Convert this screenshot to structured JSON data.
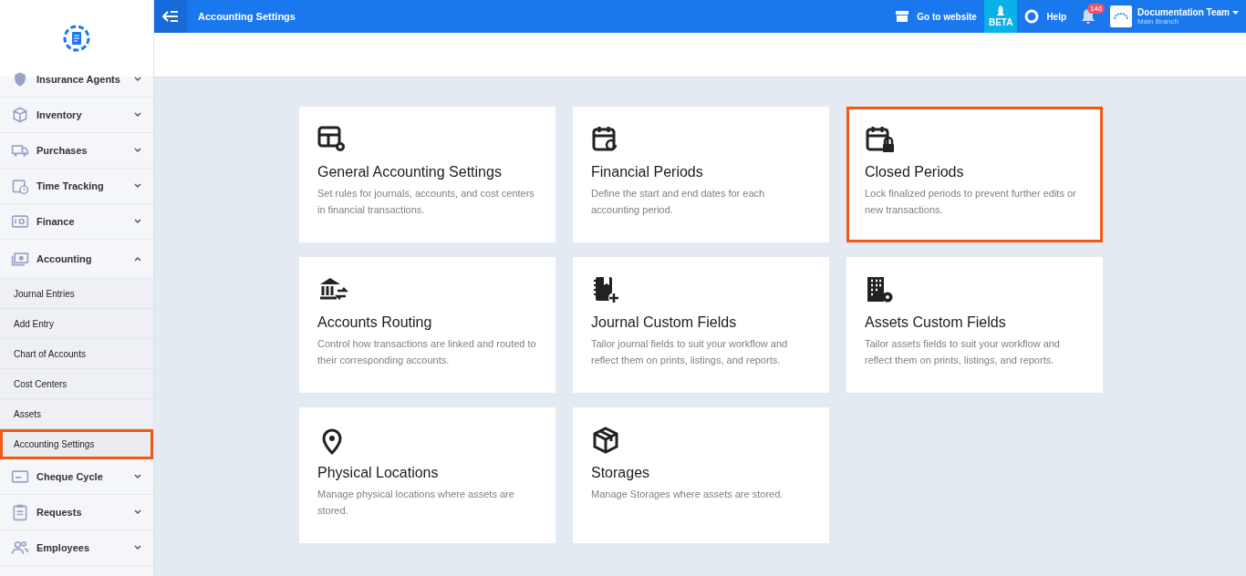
{
  "header": {
    "title": "Accounting Settings",
    "website_link": "Go to website",
    "beta_label": "BETA",
    "help_label": "Help",
    "notification_count": "146",
    "user": {
      "name": "Documentation Team",
      "branch": "Main Branch"
    }
  },
  "sidebar": {
    "items": [
      {
        "label": "Insurance Agents",
        "expanded": false
      },
      {
        "label": "Inventory",
        "expanded": false
      },
      {
        "label": "Purchases",
        "expanded": false
      },
      {
        "label": "Time Tracking",
        "expanded": false
      },
      {
        "label": "Finance",
        "expanded": false
      },
      {
        "label": "Accounting",
        "expanded": true,
        "children": [
          {
            "label": "Journal Entries",
            "selected": false,
            "highlighted": false
          },
          {
            "label": "Add Entry",
            "selected": false,
            "highlighted": false
          },
          {
            "label": "Chart of Accounts",
            "selected": false,
            "highlighted": false
          },
          {
            "label": "Cost Centers",
            "selected": false,
            "highlighted": false
          },
          {
            "label": "Assets",
            "selected": false,
            "highlighted": false
          },
          {
            "label": "Accounting Settings",
            "selected": true,
            "highlighted": true
          }
        ]
      },
      {
        "label": "Cheque Cycle",
        "expanded": false
      },
      {
        "label": "Requests",
        "expanded": false
      },
      {
        "label": "Employees",
        "expanded": false
      }
    ]
  },
  "cards": [
    {
      "title": "General Accounting Settings",
      "description": "Set rules for journals, accounts, and cost centers in financial transactions.",
      "highlighted": false
    },
    {
      "title": "Financial Periods",
      "description": "Define the start and end dates for each accounting period.",
      "highlighted": false
    },
    {
      "title": "Closed Periods",
      "description": "Lock finalized periods to prevent further edits or new transactions.",
      "highlighted": true
    },
    {
      "title": "Accounts Routing",
      "description": "Control how transactions are linked and routed to their corresponding accounts.",
      "highlighted": false
    },
    {
      "title": "Journal Custom Fields",
      "description": "Tailor journal fields to suit your workflow and reflect them on prints, listings, and reports.",
      "highlighted": false
    },
    {
      "title": "Assets Custom Fields",
      "description": "Tailor assets fields to suit your workflow and reflect them on prints, listings, and reports.",
      "highlighted": false
    },
    {
      "title": "Physical Locations",
      "description": "Manage physical locations where assets are stored.",
      "highlighted": false
    },
    {
      "title": "Storages",
      "description": "Manage Storages where assets are stored.",
      "highlighted": false
    }
  ]
}
